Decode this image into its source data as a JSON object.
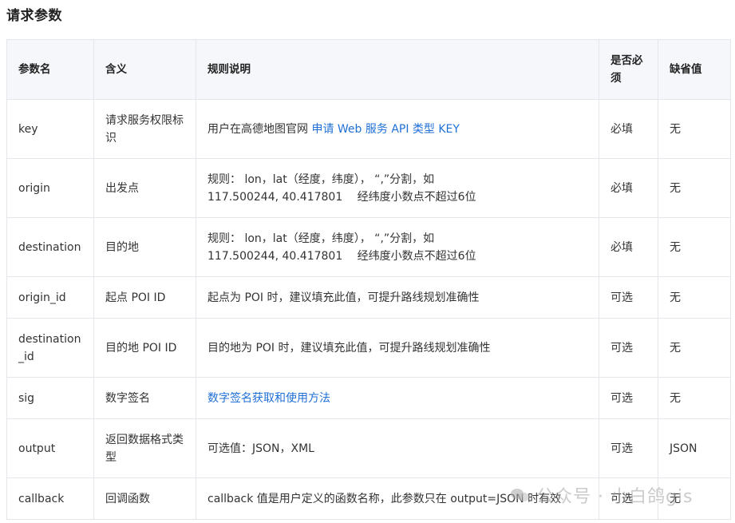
{
  "section_title": "请求参数",
  "headers": [
    "参数名",
    "含义",
    "规则说明",
    "是否必须",
    "缺省值"
  ],
  "rows": [
    {
      "name": "key",
      "meaning": "请求服务权限标识",
      "rule_prefix": "用户在高德地图官网 ",
      "rule_link": "申请 Web 服务 API 类型 KEY",
      "required": "必填",
      "default": "无"
    },
    {
      "name": "origin",
      "meaning": "出发点",
      "rule_line1": "规则： lon，lat（经度，纬度）， “,”分割，如",
      "rule_line2": "117.500244, 40.417801　 经纬度小数点不超过6位",
      "required": "必填",
      "default": "无"
    },
    {
      "name": "destination",
      "meaning": "目的地",
      "rule_line1": "规则： lon，lat（经度，纬度）， “,”分割，如",
      "rule_line2": "117.500244, 40.417801　 经纬度小数点不超过6位",
      "required": "必填",
      "default": "无"
    },
    {
      "name": "origin_id",
      "meaning": "起点 POI ID",
      "rule": "起点为 POI 时，建议填充此值，可提升路线规划准确性",
      "required": "可选",
      "default": "无"
    },
    {
      "name": "destination_id",
      "meaning": "目的地 POI ID",
      "rule": "目的地为 POI 时，建议填充此值，可提升路线规划准确性",
      "required": "可选",
      "default": "无"
    },
    {
      "name": "sig",
      "meaning": "数字签名",
      "rule_link": "数字签名获取和使用方法",
      "required": "可选",
      "default": "无"
    },
    {
      "name": "output",
      "meaning": "返回数据格式类型",
      "rule": "可选值：JSON，XML",
      "required": "可选",
      "default": "JSON"
    },
    {
      "name": "callback",
      "meaning": "回调函数",
      "rule": "callback 值是用户定义的函数名称，此参数只在 output=JSON 时有效",
      "required": "可选",
      "default": "无"
    }
  ],
  "watermark": {
    "text": "公众号 · 小白鸽gis",
    "icon": "wechat-icon"
  },
  "colors": {
    "link": "#1f6fd6",
    "header_bg": "#f5f7fa",
    "border": "#e3e6eb"
  }
}
